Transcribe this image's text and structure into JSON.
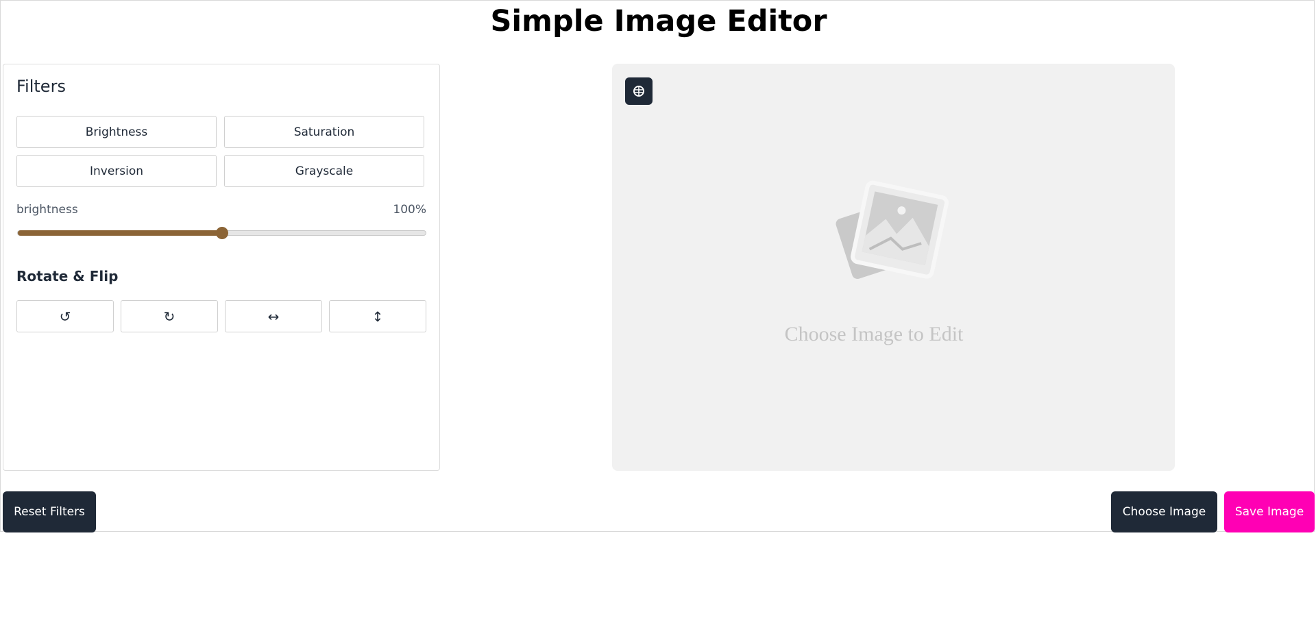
{
  "app": {
    "title": "Simple Image Editor"
  },
  "filters": {
    "heading": "Filters",
    "buttons": [
      {
        "label": "Brightness"
      },
      {
        "label": "Saturation"
      },
      {
        "label": "Inversion"
      },
      {
        "label": "Grayscale"
      }
    ],
    "active_filter": "Brightness",
    "slider": {
      "label": "brightness",
      "value_text": "100%",
      "value": 100,
      "max": 200,
      "fill_color": "#8b6436"
    }
  },
  "rotate_flip": {
    "heading": "Rotate & Flip",
    "buttons": [
      {
        "icon": "rotate-left-icon",
        "glyph": "↺"
      },
      {
        "icon": "rotate-right-icon",
        "glyph": "↻"
      },
      {
        "icon": "flip-horizontal-icon",
        "glyph": "↔"
      },
      {
        "icon": "flip-vertical-icon",
        "glyph": "↕"
      }
    ]
  },
  "preview": {
    "placeholder_text": "Choose Image to Edit",
    "ai_button_icon": "brain-icon",
    "placeholder_icon": "image-placeholder-icon",
    "background": "#f1f1f1"
  },
  "actions": {
    "reset_label": "Reset Filters",
    "choose_label": "Choose Image",
    "save_label": "Save Image",
    "dark_color": "#1f2937",
    "save_color": "#ff00b4"
  }
}
